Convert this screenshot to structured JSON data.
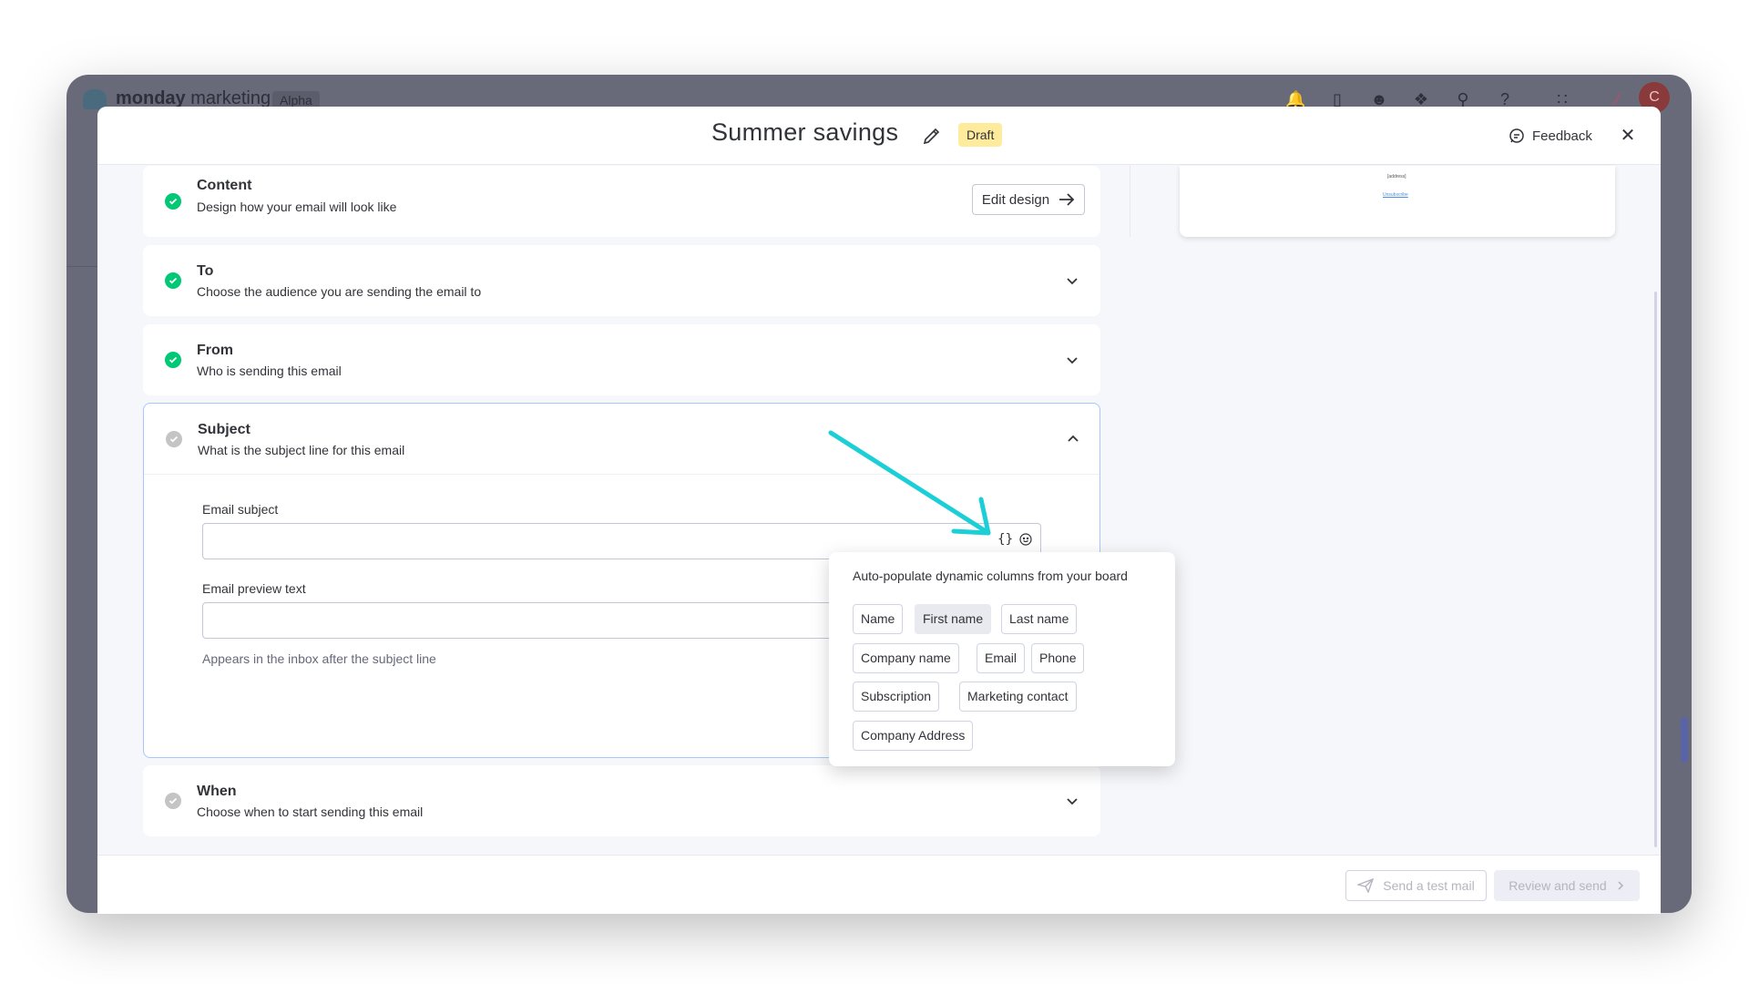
{
  "app": {
    "brand_bold": "monday",
    "brand_light": "marketing",
    "badge": "Alpha",
    "avatar_initial": "C"
  },
  "modal": {
    "title": "Summer savings",
    "status_badge": "Draft",
    "feedback_label": "Feedback"
  },
  "steps": [
    {
      "title": "Content",
      "description": "Design how your email will look like",
      "complete": true,
      "action_label": "Edit design"
    },
    {
      "title": "To",
      "description": "Choose the audience you are sending the email to",
      "complete": true
    },
    {
      "title": "From",
      "description": "Who is sending this email",
      "complete": true
    },
    {
      "title": "Subject",
      "description": "What is the subject line for this email",
      "complete": false,
      "expanded": true
    },
    {
      "title": "When",
      "description": "Choose when to start sending this email",
      "complete": false
    }
  ],
  "subject_form": {
    "email_subject_label": "Email subject",
    "email_subject_value": "",
    "dynamic_button": "{}",
    "preview_text_label": "Email preview text",
    "preview_text_value": "",
    "preview_text_hint": "Appears in the inbox after the subject line"
  },
  "dynamic_popover": {
    "title": "Auto-populate dynamic columns from your board",
    "chips": [
      "Name",
      "First name",
      "Last name",
      "Company name",
      "Email",
      "Phone",
      "Subscription",
      "Marketing contact",
      "Company Address"
    ]
  },
  "preview": {
    "address": "[address]",
    "unsubscribe": "Unsubscribe"
  },
  "footer": {
    "send_test_label": "Send a test mail",
    "review_label": "Review and send"
  },
  "colors": {
    "accent_complete": "#00c875",
    "pending": "#c4c4c4",
    "draft_badge": "#ffeb9c",
    "annotation_arrow": "#1ccfd6"
  }
}
